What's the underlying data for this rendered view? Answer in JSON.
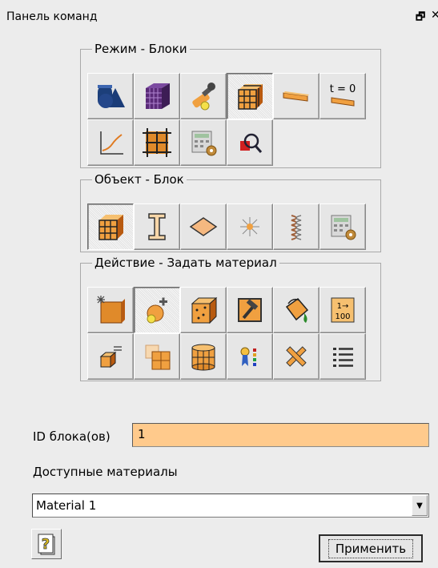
{
  "window": {
    "title": "Панель команд",
    "float_icon": "restore-icon",
    "close_icon": "close-icon"
  },
  "mode_group": {
    "legend": "Режим - Блоки",
    "buttons": [
      {
        "icon": "geometry-icon",
        "pressed": false
      },
      {
        "icon": "mesh-icon",
        "pressed": false
      },
      {
        "icon": "tools-icon",
        "pressed": false
      },
      {
        "icon": "blocks-icon",
        "pressed": true
      },
      {
        "icon": "bar-element-icon",
        "pressed": false
      },
      {
        "icon": "initial-time-icon",
        "label": "t = 0",
        "pressed": false
      },
      {
        "icon": "graph-icon",
        "pressed": false
      },
      {
        "icon": "grid-blocks-icon",
        "pressed": false
      },
      {
        "icon": "calculator-settings-icon",
        "pressed": false
      },
      {
        "icon": "magnifier-icon",
        "pressed": false
      }
    ]
  },
  "object_group": {
    "legend": "Объект - Блок",
    "buttons": [
      {
        "icon": "block-cube-icon",
        "pressed": true
      },
      {
        "icon": "beam-icon",
        "pressed": false
      },
      {
        "icon": "surface-icon",
        "pressed": false
      },
      {
        "icon": "node-icon",
        "pressed": false
      },
      {
        "icon": "spring-icon",
        "pressed": false
      },
      {
        "icon": "calculator-settings-icon",
        "pressed": false
      }
    ]
  },
  "action_group": {
    "legend": "Действие - Задать материал",
    "buttons": [
      {
        "icon": "new-material-icon",
        "pressed": false
      },
      {
        "icon": "assign-material-icon",
        "pressed": true
      },
      {
        "icon": "block-points-icon",
        "pressed": false
      },
      {
        "icon": "hammer-icon",
        "pressed": false
      },
      {
        "icon": "paint-bucket-icon",
        "pressed": false
      },
      {
        "icon": "renumber-icon",
        "label_top": "1→",
        "label_bottom": "100",
        "pressed": false
      },
      {
        "icon": "block-list-icon",
        "pressed": false
      },
      {
        "icon": "split-blocks-icon",
        "pressed": false
      },
      {
        "icon": "cylinder-icon",
        "pressed": false
      },
      {
        "icon": "color-legend-icon",
        "pressed": false
      },
      {
        "icon": "delete-icon",
        "pressed": false
      },
      {
        "icon": "list-icon",
        "pressed": false
      }
    ]
  },
  "form": {
    "id_label": "ID блока(ов)",
    "id_value": "1",
    "materials_label": "Доступные материалы",
    "material_selected": "Material 1",
    "apply_label": "Применить"
  },
  "colors": {
    "orange": "#f0a040",
    "dark_orange": "#b85a10",
    "highlight_field": "#ffca8c",
    "blue": "#1a3c78",
    "purple": "#5a2a78"
  }
}
